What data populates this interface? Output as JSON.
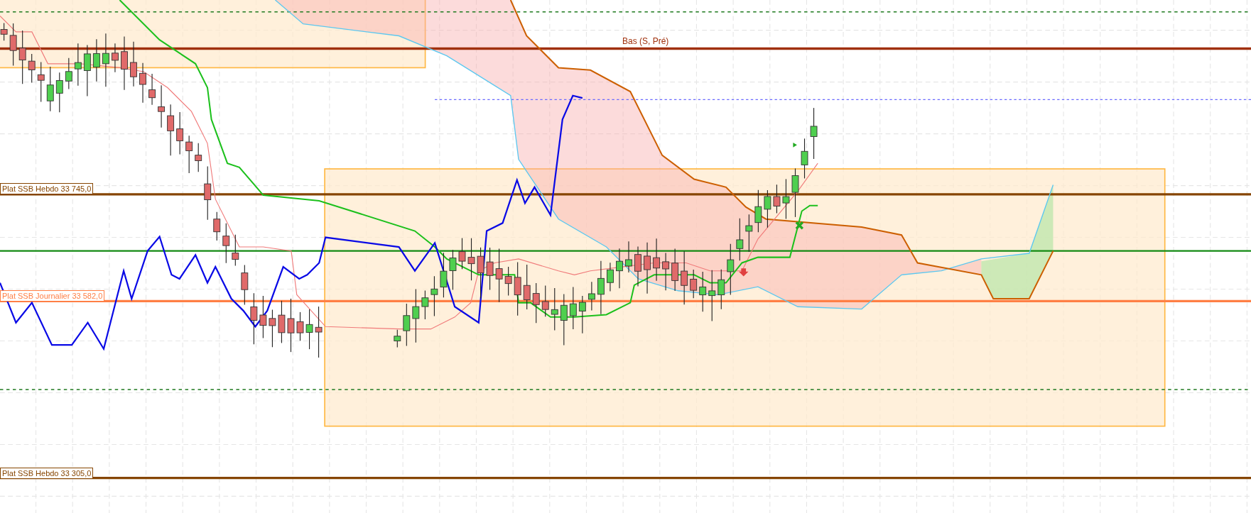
{
  "top_level_label": {
    "text": "Bas (S, Pré)",
    "color": "#a0300c"
  },
  "level_labels": [
    {
      "text": "Plat SSB Hebdo 33 745,0",
      "color": "#864500"
    },
    {
      "text": "Plat SSB Journalier 33 582,0",
      "color": "#ff7f45"
    },
    {
      "text": "Plat SSB Hebdo 33 305,0",
      "color": "#864500"
    }
  ]
}
